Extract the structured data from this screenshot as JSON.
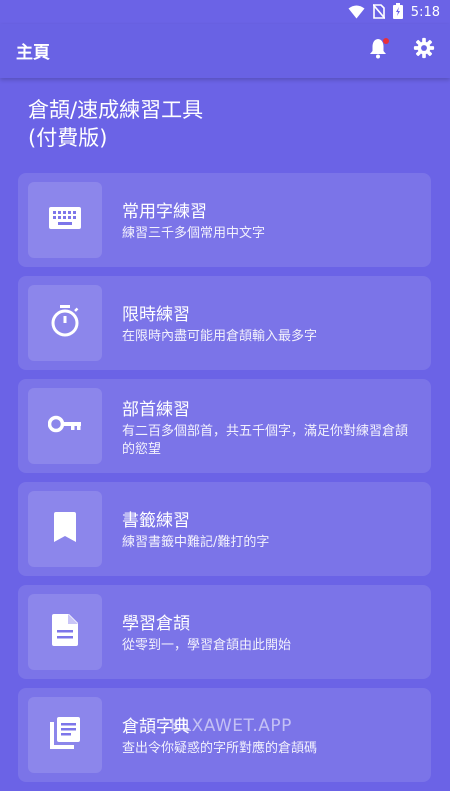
{
  "status_bar": {
    "time": "5:18"
  },
  "app_bar": {
    "title": "主頁"
  },
  "hero": {
    "line1": "倉頡/速成練習工具",
    "line2": "(付費版)"
  },
  "cards": [
    {
      "title": "常用字練習",
      "subtitle": "練習三千多個常用中文字",
      "icon": "keyboard-icon"
    },
    {
      "title": "限時練習",
      "subtitle": "在限時內盡可能用倉頡輸入最多字",
      "icon": "timer-icon"
    },
    {
      "title": "部首練習",
      "subtitle": "有二百多個部首，共五千個字，滿足你對練習倉頡的慾望",
      "icon": "key-icon"
    },
    {
      "title": "書籤練習",
      "subtitle": "練習書籤中難記/難打的字",
      "icon": "bookmark-icon"
    },
    {
      "title": "學習倉頡",
      "subtitle": "從零到一，學習倉頡由此開始",
      "icon": "document-icon"
    },
    {
      "title": "倉頡字典",
      "subtitle": "查出令你疑惑的字所對應的倉頡碼",
      "icon": "dictionary-icon"
    }
  ],
  "watermark": "KLXAWET.APP",
  "colors": {
    "background": "#6b63e6",
    "notification_dot": "#e8303a"
  }
}
